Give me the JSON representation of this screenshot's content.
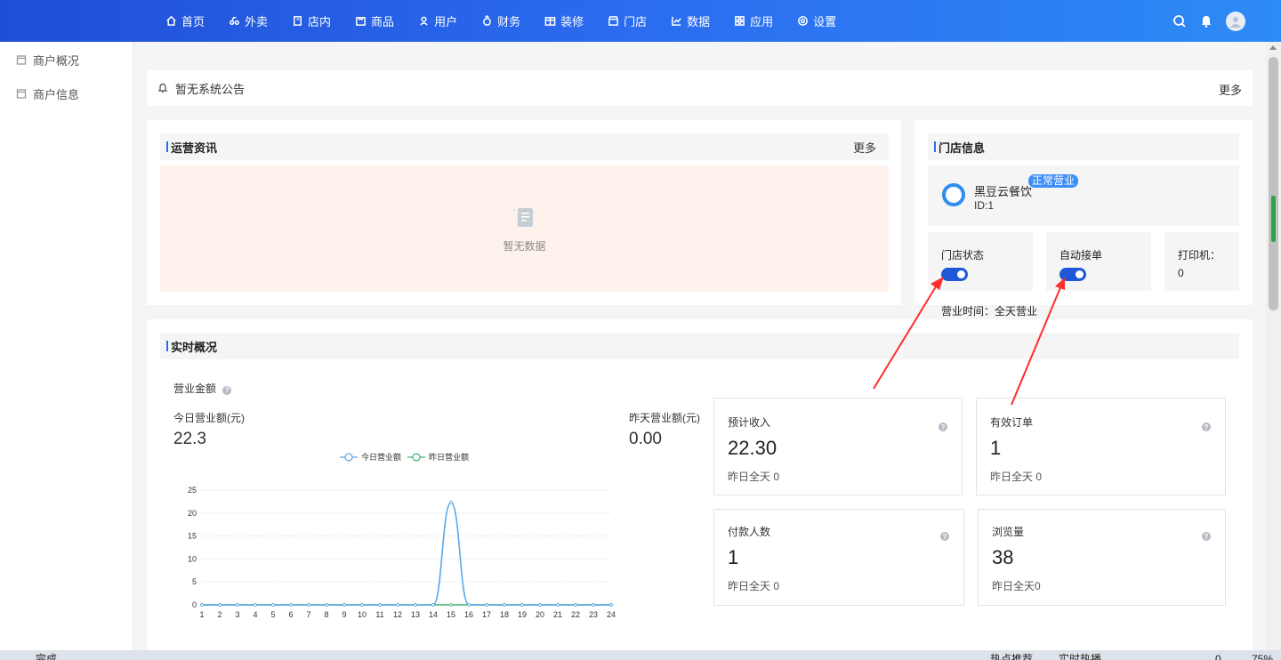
{
  "nav": {
    "items": [
      {
        "label": "首页",
        "icon": "home-icon"
      },
      {
        "label": "外卖",
        "icon": "takeout-icon"
      },
      {
        "label": "店内",
        "icon": "dine-in-icon"
      },
      {
        "label": "商品",
        "icon": "goods-icon"
      },
      {
        "label": "用户",
        "icon": "user-icon"
      },
      {
        "label": "财务",
        "icon": "finance-icon"
      },
      {
        "label": "装修",
        "icon": "decor-icon"
      },
      {
        "label": "门店",
        "icon": "store-icon"
      },
      {
        "label": "数据",
        "icon": "data-icon"
      },
      {
        "label": "应用",
        "icon": "apps-icon"
      },
      {
        "label": "设置",
        "icon": "settings-icon"
      }
    ]
  },
  "sidebar": {
    "items": [
      {
        "label": "商户概况"
      },
      {
        "label": "商户信息"
      }
    ]
  },
  "notice": {
    "text": "暂无系统公告",
    "more": "更多"
  },
  "ops": {
    "title": "运营资讯",
    "more": "更多",
    "empty": "暂无数据"
  },
  "store": {
    "title": "门店信息",
    "name": "黑豆云餐饮",
    "badge": "正常营业",
    "id": "ID:1",
    "status_label": "门店状态",
    "status_on": true,
    "auto_label": "自动接单",
    "auto_on": true,
    "printer_label": "打印机：",
    "printer_value": "0",
    "hours": "营业时间：全天营业"
  },
  "realtime": {
    "title": "实时概况",
    "revenue_label": "营业金额",
    "today_label": "今日营业额(元)",
    "today_value": "22.3",
    "yesterday_label": "昨天营业额(元)",
    "yesterday_value": "0.00",
    "stats": [
      {
        "title": "预计收入",
        "value": "22.30",
        "sub": "昨日全天 0"
      },
      {
        "title": "有效订单",
        "value": "1",
        "sub": "昨日全天 0"
      },
      {
        "title": "付款人数",
        "value": "1",
        "sub": "昨日全天 0"
      },
      {
        "title": "浏览量",
        "value": "38",
        "sub": "昨日全天0"
      }
    ]
  },
  "chart_data": {
    "type": "line",
    "title": "",
    "xlabel": "",
    "ylabel": "",
    "x": [
      1,
      2,
      3,
      4,
      5,
      6,
      7,
      8,
      9,
      10,
      11,
      12,
      13,
      14,
      15,
      16,
      17,
      18,
      19,
      20,
      21,
      22,
      23,
      24
    ],
    "ylim": [
      0,
      25
    ],
    "yticks": [
      0,
      5,
      10,
      15,
      20,
      25
    ],
    "legend_position": "top-center",
    "series": [
      {
        "name": "今日营业额",
        "color": "#5aa7e8",
        "values": [
          0,
          0,
          0,
          0,
          0,
          0,
          0,
          0,
          0,
          0,
          0,
          0,
          0,
          0,
          22.3,
          0,
          0,
          0,
          0,
          0,
          0,
          0,
          0,
          0
        ]
      },
      {
        "name": "昨日营业额",
        "color": "#3cb371",
        "values": [
          0,
          0,
          0,
          0,
          0,
          0,
          0,
          0,
          0,
          0,
          0,
          0,
          0,
          0,
          0,
          0,
          0,
          0,
          0,
          0,
          0,
          0,
          0,
          0
        ]
      }
    ]
  },
  "statusbar": {
    "left": "完成",
    "hot": "热点推荐",
    "live": "实时热播",
    "zoom": "75%",
    "count": "0"
  },
  "colors": {
    "primary": "#2d6cf0",
    "annotation": "#ff2d2d"
  }
}
